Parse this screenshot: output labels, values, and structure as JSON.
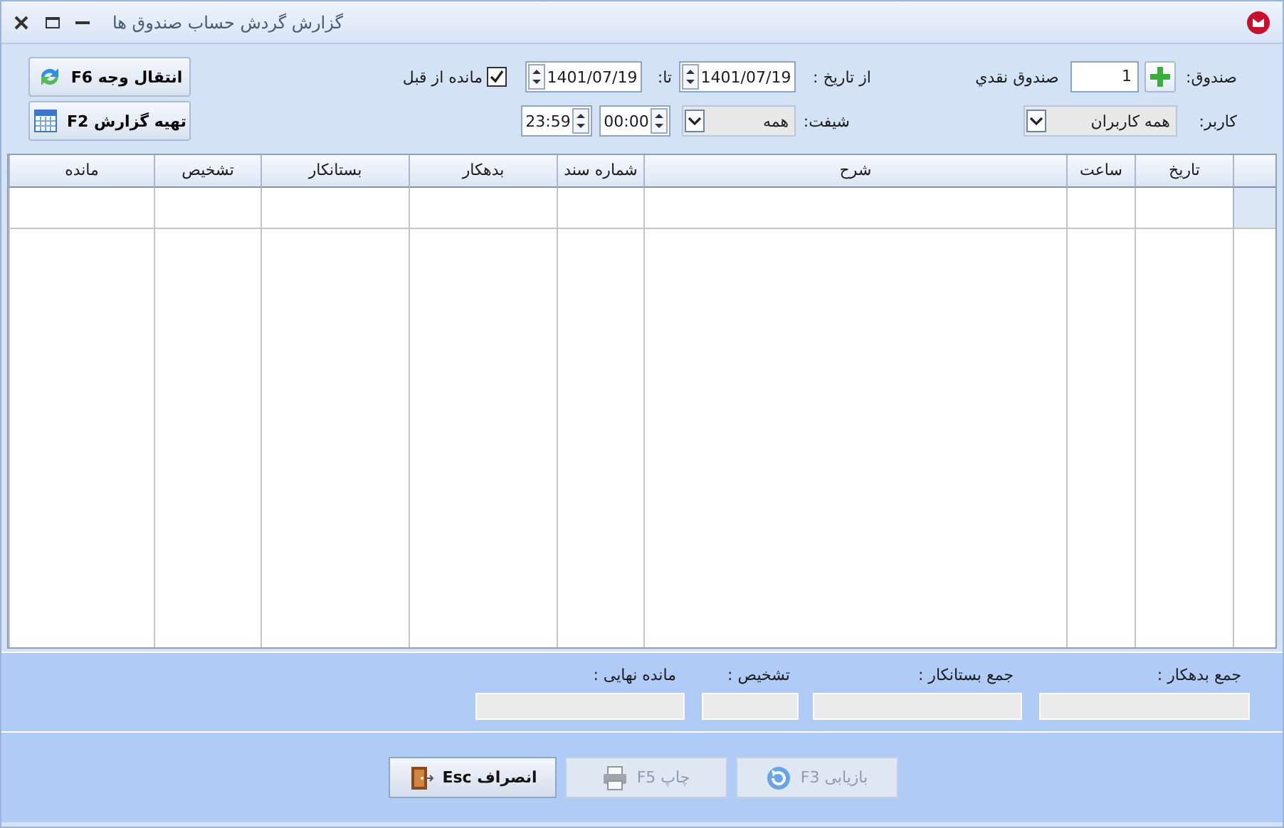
{
  "window": {
    "title": "گزارش گردش حساب صندوق ها"
  },
  "filters": {
    "fund_label": "صندوق:",
    "fund_code": "1",
    "fund_name": "صندوق نقدي",
    "from_label": "از تاریخ :",
    "from_date": "1401/07/19",
    "to_label": "تا:",
    "to_date": "1401/07/19",
    "carry_over": {
      "label": "مانده از قبل",
      "checked": true
    },
    "user_label": "کاربر:",
    "user": "همه کاربران",
    "shift_label": "شیفت:",
    "shift": "همه",
    "from_time": "00:00",
    "to_time": "23:59"
  },
  "side_buttons": [
    {
      "label": "انتقال وجه F6",
      "kind": "transfer"
    },
    {
      "label": "تهیه گزارش F2",
      "kind": "report"
    }
  ],
  "table": {
    "columns": [
      "تاریخ",
      "ساعت",
      "شرح",
      "شماره سند",
      "بدهکار",
      "بستانکار",
      "تشخیص",
      "مانده"
    ]
  },
  "totals": [
    {
      "label": "جمع بدهکار :"
    },
    {
      "label": "جمع بستانکار :"
    },
    {
      "label": "تشخیص :"
    },
    {
      "label": "مانده نهایی :"
    }
  ],
  "buttons": [
    {
      "label": "بازیابی F3",
      "kind": "refresh",
      "disabled": true
    },
    {
      "label": "چاپ F5",
      "kind": "print",
      "disabled": true
    },
    {
      "label": "انصراف Esc",
      "kind": "exit",
      "disabled": false
    }
  ]
}
